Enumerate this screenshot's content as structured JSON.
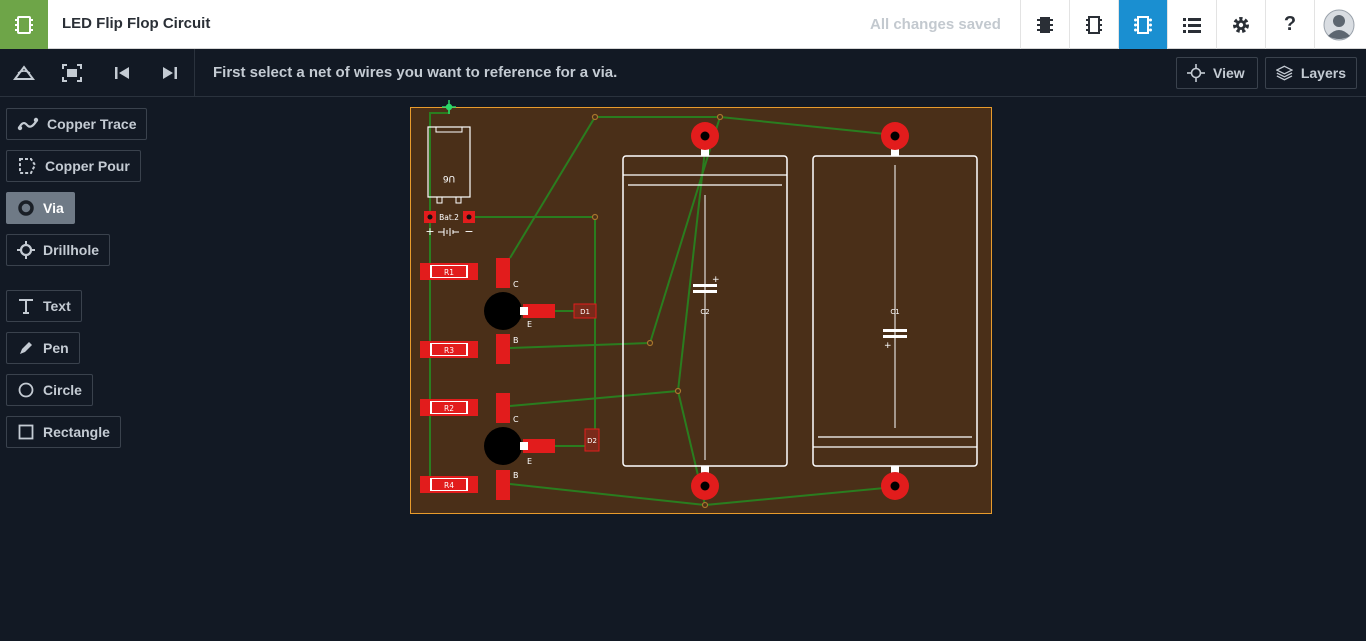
{
  "header": {
    "app_logo": "circuit-chip-icon",
    "title": "LED Flip Flop Circuit",
    "save_status": "All changes saved",
    "icons": [
      "components-icon",
      "chip-icon",
      "pcb-icon",
      "list-icon",
      "gear-icon",
      "help-icon",
      "avatar-icon"
    ],
    "help_label": "?"
  },
  "toolbar": {
    "hint": "First select a net of wires you want to reference for a via.",
    "view_label": "View",
    "layers_label": "Layers"
  },
  "tools": [
    {
      "label": "Copper Trace",
      "icon": "trace-icon"
    },
    {
      "label": "Copper Pour",
      "icon": "pour-icon"
    },
    {
      "label": "Via",
      "icon": "via-icon",
      "active": true
    },
    {
      "label": "Drillhole",
      "icon": "drillhole-icon"
    },
    {
      "label": "Text",
      "icon": "text-icon"
    },
    {
      "label": "Pen",
      "icon": "pen-icon"
    },
    {
      "label": "Circle",
      "icon": "circle-icon"
    },
    {
      "label": "Rectangle",
      "icon": "rectangle-icon"
    }
  ],
  "board": {
    "labels": {
      "u6": "U6",
      "bat": "Bat.2",
      "plus": "+",
      "minus": "−",
      "r1": "R1",
      "r2": "R2",
      "r3": "R3",
      "r4": "R4",
      "d1": "D1",
      "d2": "D2",
      "c1": "C1",
      "c2": "C2",
      "q_c": "C",
      "q_e": "E",
      "q_b": "B"
    },
    "colors": {
      "board": "#4a2f18",
      "outline": "#e89b2c",
      "pad": "#e21c1c",
      "trace": "#2a7d1f",
      "silk": "#ffffff"
    }
  }
}
